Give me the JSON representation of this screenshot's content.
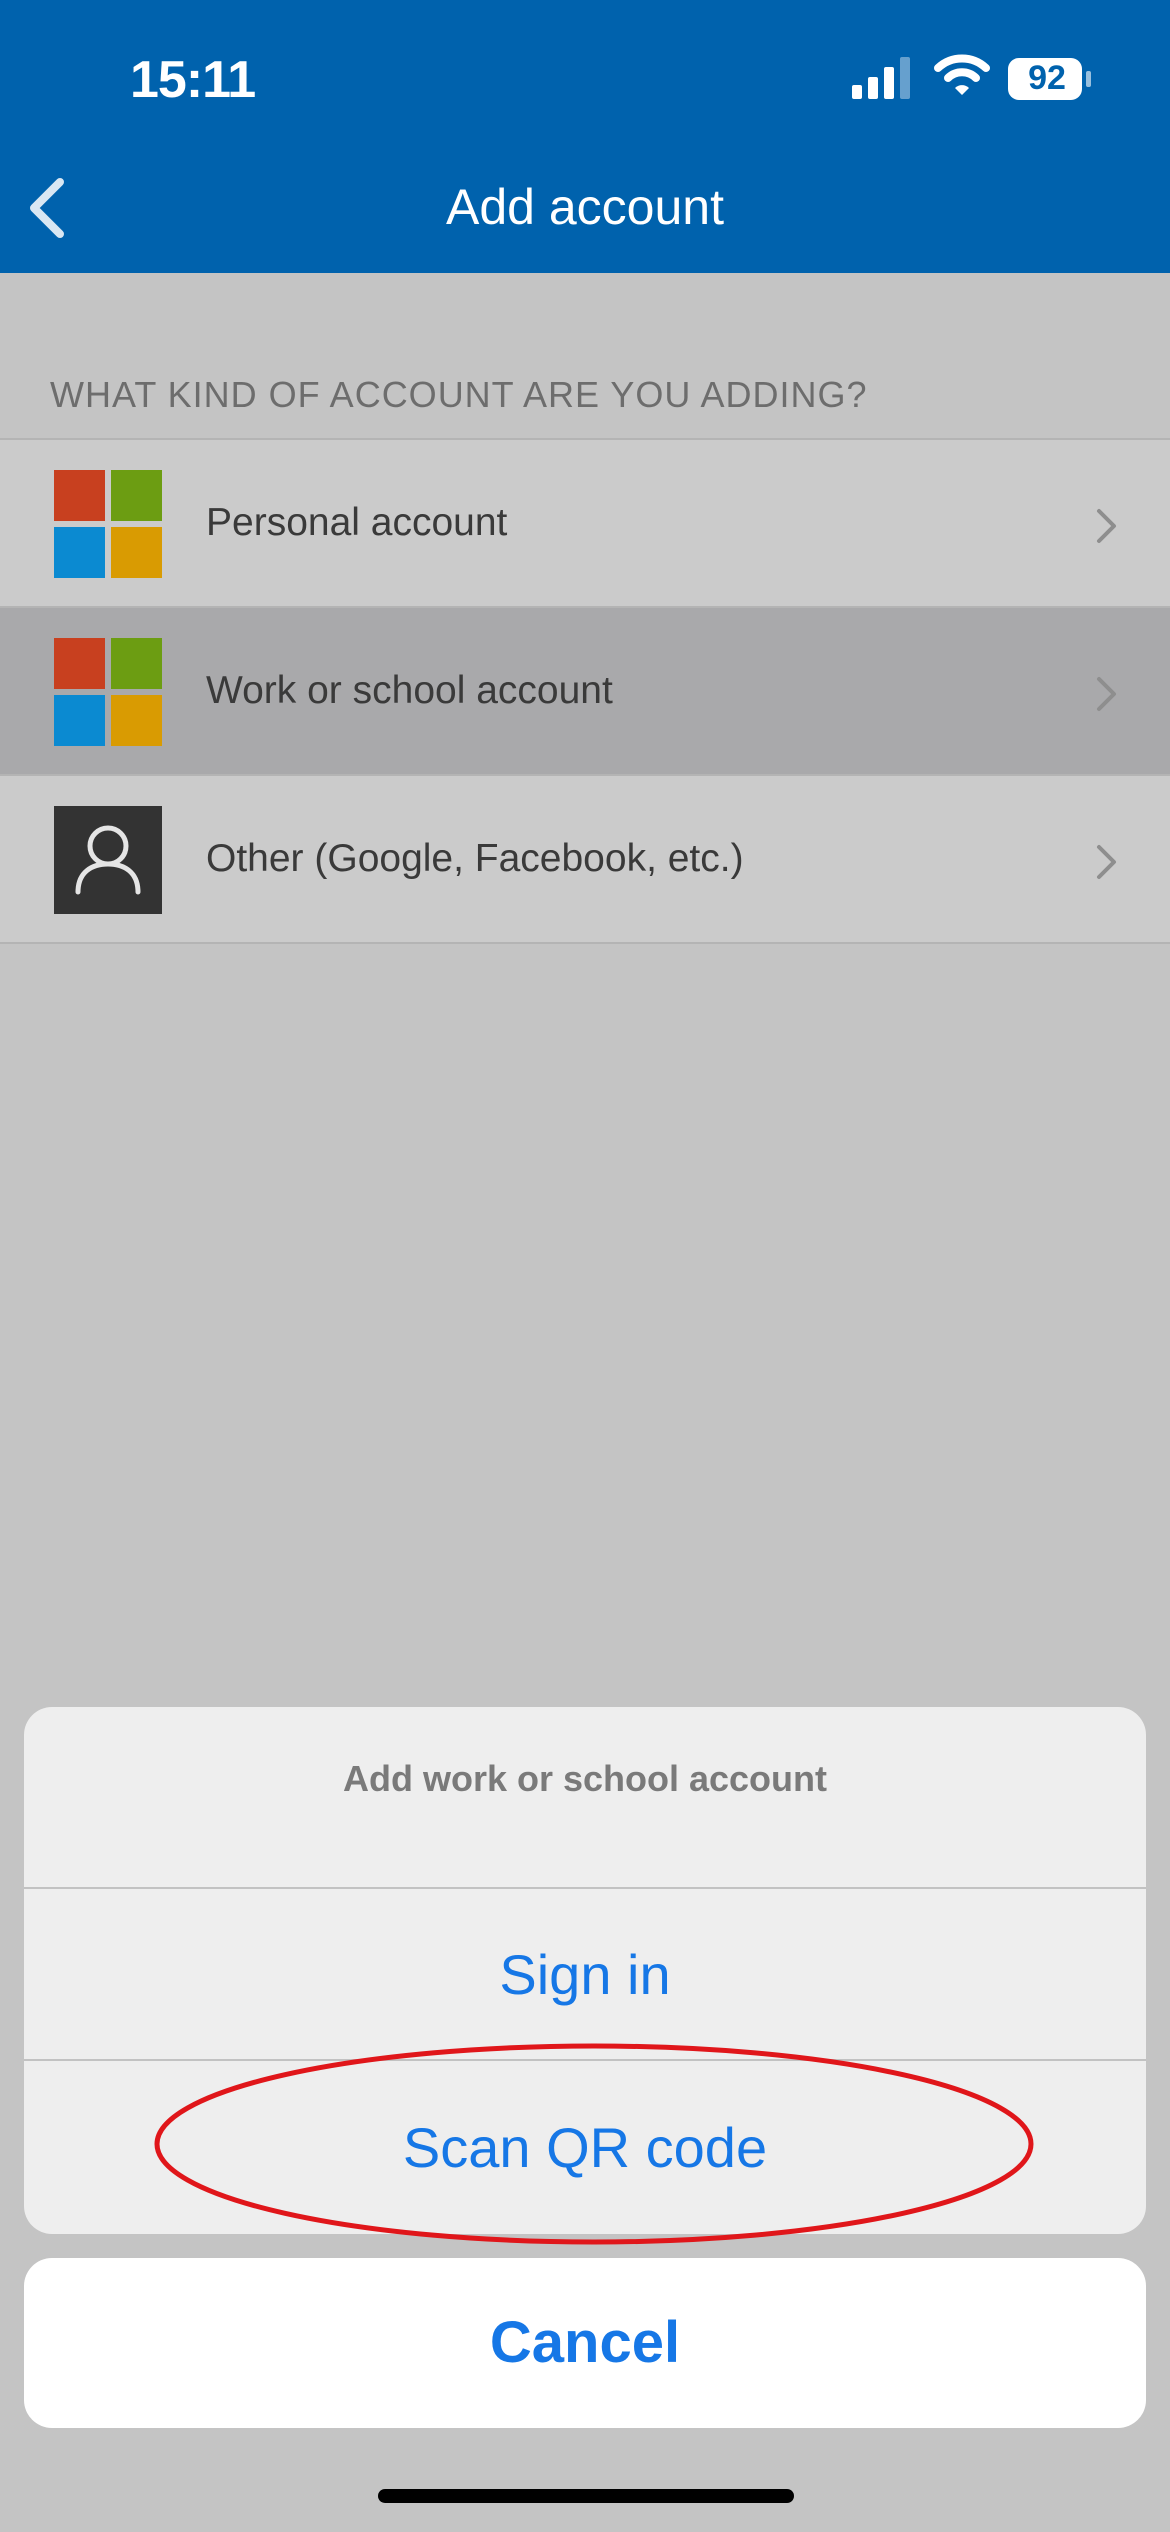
{
  "status_bar": {
    "time": "15:11",
    "battery": "92",
    "icons": [
      "signal-icon",
      "wifi-icon",
      "battery-icon"
    ]
  },
  "nav": {
    "title": "Add account",
    "back_icon": "chevron-left-icon"
  },
  "section_header": "WHAT KIND OF ACCOUNT ARE YOU ADDING?",
  "accounts": [
    {
      "label": "Personal account",
      "icon": "microsoft-logo-icon"
    },
    {
      "label": "Work or school account",
      "icon": "microsoft-logo-icon",
      "selected": true
    },
    {
      "label": "Other (Google, Facebook, etc.)",
      "icon": "person-icon"
    }
  ],
  "action_sheet": {
    "title": "Add work or school account",
    "options": [
      "Sign in",
      "Scan QR code"
    ],
    "cancel": "Cancel"
  },
  "colors": {
    "header": "#0062ad",
    "accent": "#1677e6",
    "annotation": "#e0161a",
    "ms_red": "#c8401f",
    "ms_green": "#6c9d12",
    "ms_blue": "#0b8ad1",
    "ms_yellow": "#d99b02"
  }
}
